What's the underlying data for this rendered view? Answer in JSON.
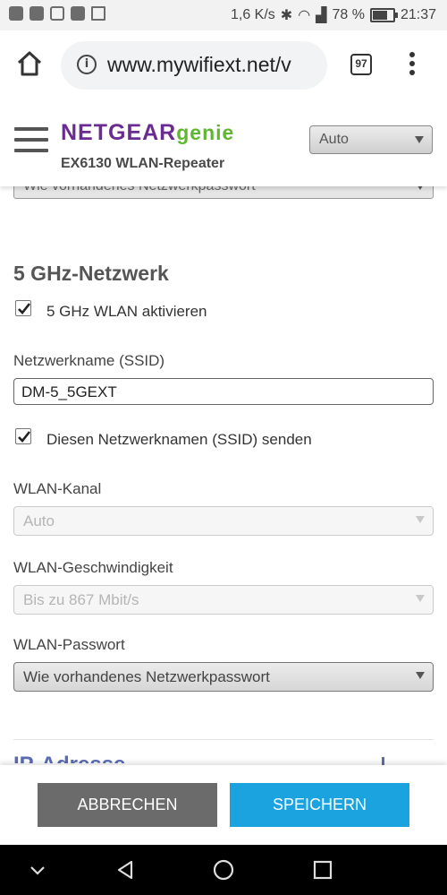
{
  "status_bar": {
    "network_speed": "1,6 K/s",
    "battery": "78 %",
    "battery_level": 0.78,
    "time": "21:37"
  },
  "browser": {
    "url": "www.mywifiext.net/v",
    "tab_count": "97"
  },
  "header": {
    "logo_netgear": "NETGEAR",
    "logo_genie": "genie",
    "device": "EX6130 WLAN-Repeater",
    "language": "Auto"
  },
  "content": {
    "prev_password_select": "Wie vorhandenes Netzwerkpasswort",
    "section_title": "5 GHz-Netzwerk",
    "enable_5ghz_label": "5 GHz WLAN aktivieren",
    "enable_5ghz_checked": true,
    "ssid_label": "Netzwerkname (SSID)",
    "ssid_value": "DM-5_5GEXT",
    "broadcast_label": "Diesen Netzwerknamen (SSID) senden",
    "broadcast_checked": true,
    "channel_label": "WLAN-Kanal",
    "channel_value": "Auto",
    "speed_label": "WLAN-Geschwindigkeit",
    "speed_value": "Bis zu 867 Mbit/s",
    "password_label": "WLAN-Passwort",
    "password_value": "Wie vorhandenes Netzwerkpasswort",
    "next_section_title": "IP-Adresse"
  },
  "actions": {
    "cancel": "ABBRECHEN",
    "save": "SPEICHERN"
  },
  "colors": {
    "netgear_purple": "#6b2c91",
    "genie_green": "#5fb731",
    "save_blue": "#1ba3e0",
    "cancel_gray": "#6b6b6b"
  }
}
